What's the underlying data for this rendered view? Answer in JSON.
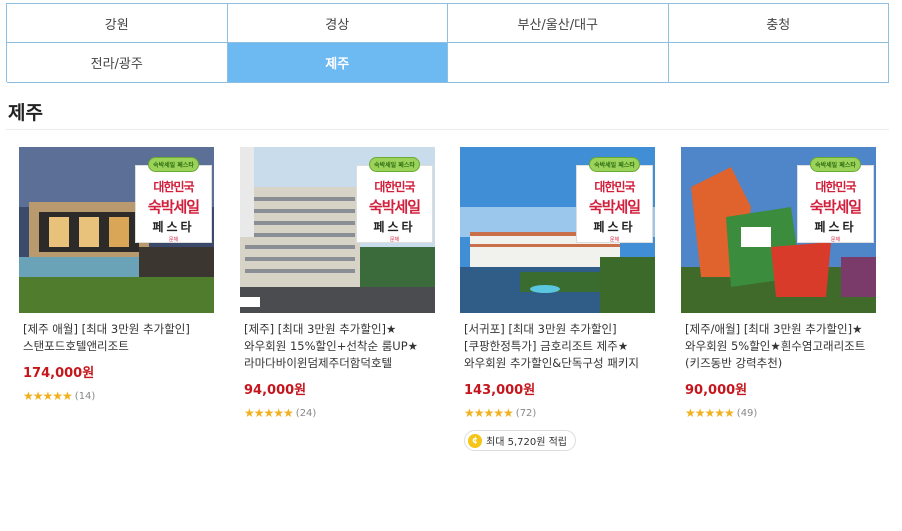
{
  "regions": [
    "강원",
    "경상",
    "부산/울산/대구",
    "충청",
    "전라/광주",
    "제주",
    "",
    ""
  ],
  "active_region": "제주",
  "section_title": "제주",
  "badge": {
    "top": "숙박세일 페스타",
    "line1": "대한민국",
    "line2": "숙박세일",
    "line3": "페스타",
    "line4": "문체"
  },
  "products": [
    {
      "title": "[제주 애월] [최대 3만원 추가할인]스탠포드호텔앤리조트",
      "price": "174,000원",
      "stars": "★★★★★",
      "reviews": "(14)"
    },
    {
      "title": "[제주] [최대 3만원 추가할인]★와우회원 15%할인+선착순 룸UP★라마다바이윈덤제주더함덕호텔",
      "price": "94,000원",
      "stars": "★★★★★",
      "reviews": "(24)"
    },
    {
      "title": "[서귀포] [최대 3만원 추가할인][쿠팡한정특가] 금호리조트 제주★와우회원 추가할인&단독구성 패키지",
      "price": "143,000원",
      "stars": "★★★★★",
      "reviews": "(72)",
      "points": "최대 5,720원 적립"
    },
    {
      "title": "[제주/애월] [최대 3만원 추가할인]★와우회원 5%할인★흰수염고래리조트(키즈동반 강력추천)",
      "price": "90,000원",
      "stars": "★★★★★",
      "reviews": "(49)"
    }
  ],
  "colors": {
    "active_tab": "#6db9f2",
    "price": "#c4161c",
    "star": "#f2b01e",
    "border": "#8fbfe0"
  }
}
